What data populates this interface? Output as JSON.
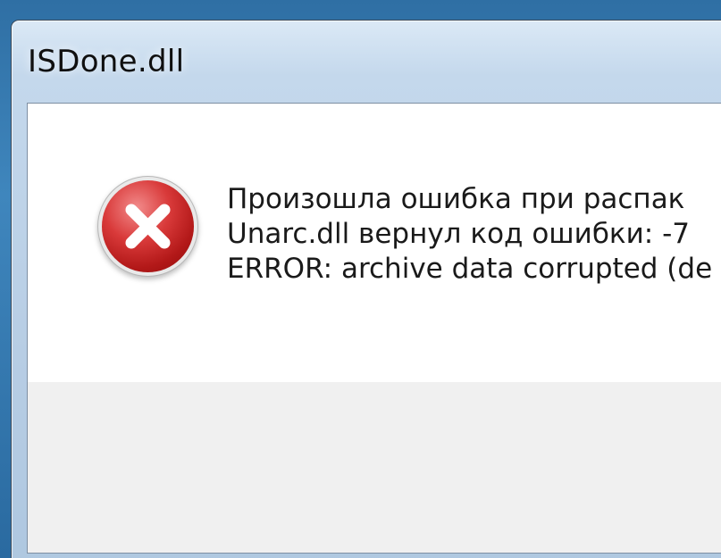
{
  "window": {
    "title": "ISDone.dll"
  },
  "dialog": {
    "icon": "error-icon",
    "lines": [
      "Произошла ошибка при распак",
      "Unarc.dll вернул код ошибки: -7",
      "ERROR: archive data corrupted (de"
    ]
  },
  "colors": {
    "icon_red": "#c62020",
    "button_strip": "#f0f0f0",
    "desktop_blue": "#3f86bd"
  }
}
